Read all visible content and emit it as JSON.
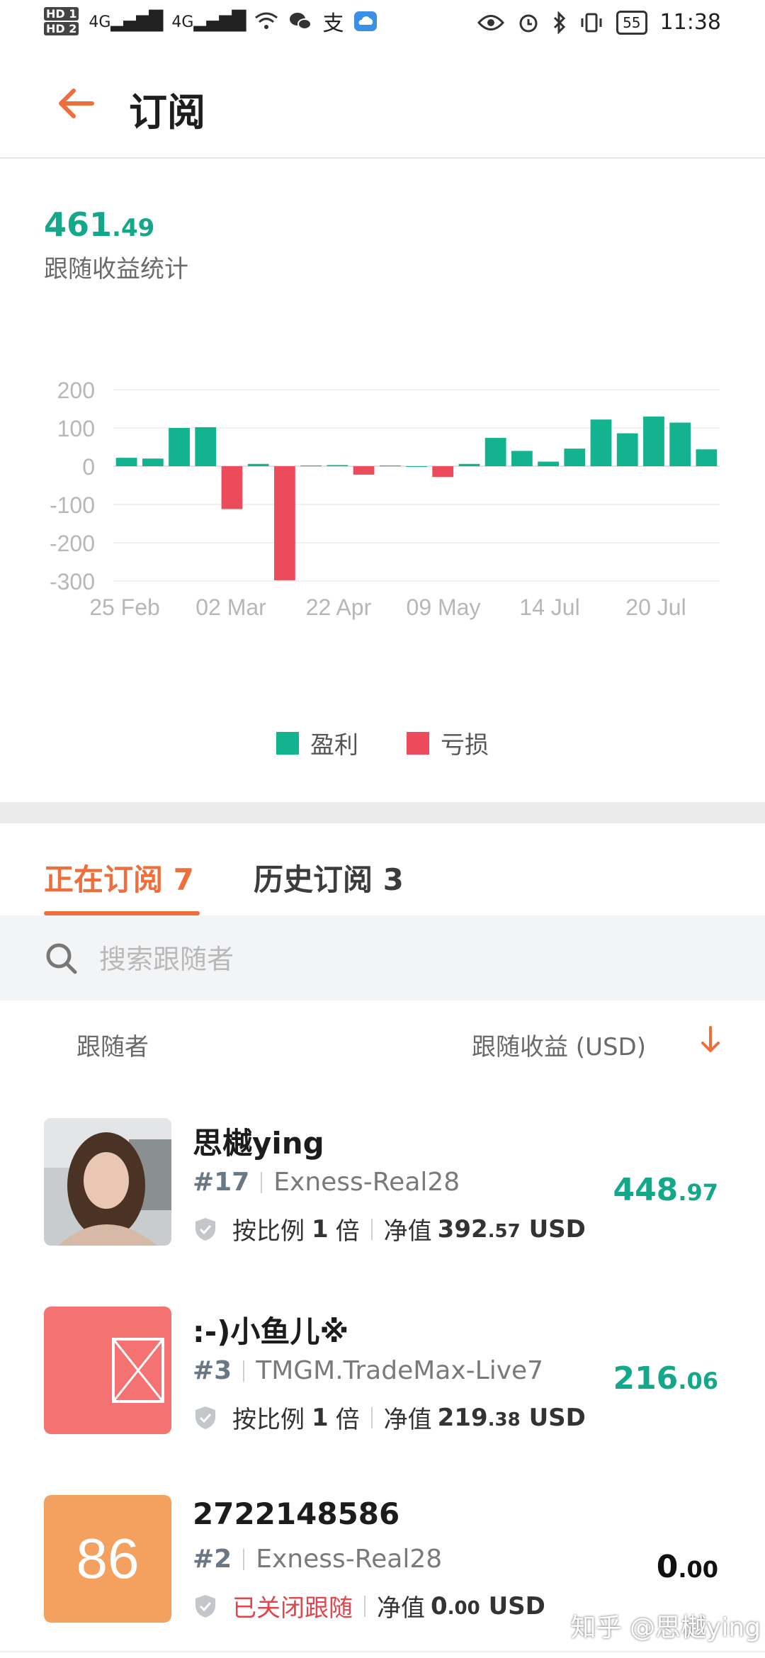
{
  "status_bar": {
    "time": "11:38",
    "battery": "55",
    "hd1": "HD 1",
    "hd2": "HD 2",
    "net1": "4G",
    "net2": "4G",
    "alipay_glyph": "支"
  },
  "header": {
    "title": "订阅"
  },
  "stats": {
    "total_int": "461",
    "total_dec": ".49",
    "total_label": "跟随收益统计"
  },
  "chart_data": {
    "type": "bar",
    "categories": [
      "25 Feb",
      "",
      "",
      "",
      "02 Mar",
      "",
      "",
      "",
      "22 Apr",
      "",
      "",
      "",
      "09 May",
      "",
      "",
      "",
      "14 Jul",
      "",
      "",
      "",
      "20 Jul",
      "",
      "",
      ""
    ],
    "tick_labels": [
      "25 Feb",
      "02 Mar",
      "22 Apr",
      "09 May",
      "14 Jul",
      "20 Jul"
    ],
    "y_ticks": [
      "200",
      "100",
      "0",
      "-100",
      "-200",
      "-300"
    ],
    "ylim": [
      -300,
      200
    ],
    "values": [
      22,
      20,
      100,
      102,
      -112,
      6,
      -298,
      2,
      3,
      -22,
      2,
      0,
      -28,
      6,
      74,
      40,
      12,
      46,
      122,
      86,
      130,
      114,
      44
    ],
    "legend": [
      "盈利",
      "亏损"
    ],
    "colors": {
      "profit": "#13b38f",
      "loss": "#ec4b5c"
    }
  },
  "tabs": {
    "active_label": "正在订阅",
    "active_count": "7",
    "history_label": "历史订阅",
    "history_count": "3"
  },
  "search": {
    "placeholder": "搜索跟随者"
  },
  "list_header": {
    "left": "跟随者",
    "right": "跟随收益 (USD)"
  },
  "followers": [
    {
      "name": "思樾ying",
      "rank": "#17",
      "server": "Exness-Real28",
      "ratio_prefix": "按比例",
      "ratio_value": "1",
      "ratio_suffix": "倍",
      "equity_label": "净值",
      "equity_int": "392",
      "equity_dec": ".57",
      "equity_unit": "USD",
      "profit_int": "448",
      "profit_dec": ".97",
      "profit_color": "#13a889"
    },
    {
      "name": ":-)小鱼儿※",
      "rank": "#3",
      "server": "TMGM.TradeMax-Live7",
      "ratio_prefix": "按比例",
      "ratio_value": "1",
      "ratio_suffix": "倍",
      "equity_label": "净值",
      "equity_int": "219",
      "equity_dec": ".38",
      "equity_unit": "USD",
      "profit_int": "216",
      "profit_dec": ".06",
      "profit_color": "#13a889"
    },
    {
      "name": "2722148586",
      "rank": "#2",
      "server": "Exness-Real28",
      "avatar_text": "86",
      "closed_label": "已关闭跟随",
      "equity_label": "净值",
      "equity_int": "0",
      "equity_dec": ".00",
      "equity_unit": "USD",
      "profit_int": "0",
      "profit_dec": ".00",
      "profit_color": "#111111"
    }
  ],
  "watermark": "知乎 @思樾ying"
}
